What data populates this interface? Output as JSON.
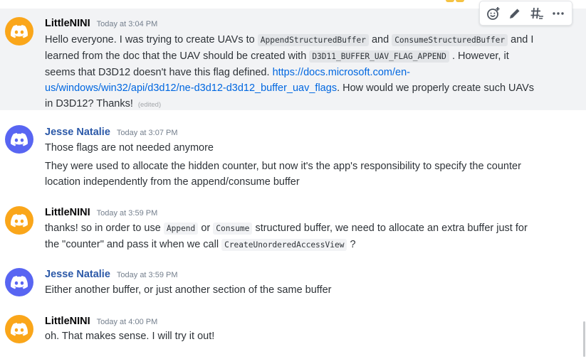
{
  "colors": {
    "avatar_orange": "#faa61a",
    "avatar_blurple": "#5865f2",
    "author_default": "#060607",
    "author_moderator": "#2c59a8",
    "link": "#0067e0",
    "highlight": "#f2f3f5"
  },
  "toolbar": {
    "icons": [
      "add-reaction-icon",
      "edit-pencil-icon",
      "thread-icon",
      "more-dots-icon"
    ]
  },
  "messages": [
    {
      "author": "LittleNINI",
      "timestamp": "Today at 3:04 PM",
      "avatar_icon": "discord-logo-icon",
      "p1_a": "Hello everyone. I was trying to create UAVs to",
      "p1_code1": "AppendStructuredBuffer",
      "p1_b": "and",
      "p1_code2": "ConsumeStructuredBuffer",
      "p1_c": "and I learned from the doc that the UAV should be created with",
      "p1_code3": "D3D11_BUFFER_UAV_FLAG_APPEND",
      "p1_d": ".",
      "p1_e": "However, it seems that D3D12 doesn't have this flag defined.",
      "p1_link": "https://docs.microsoft.com/en-us/windows/win32/api/d3d12/ne-d3d12-d3d12_buffer_uav_flags",
      "p1_f": ". How would we properly create such UAVs in D3D12? Thanks!",
      "edited": "(edited)"
    },
    {
      "author": "Jesse Natalie",
      "timestamp": "Today at 3:07 PM",
      "avatar_icon": "discord-logo-icon",
      "line1": "Those flags are not needed anymore",
      "line2": "They were used to allocate the hidden counter, but now it's the app's responsibility to specify the counter location independently from the append/consume buffer"
    },
    {
      "author": "LittleNINI",
      "timestamp": "Today at 3:59 PM",
      "avatar_icon": "discord-logo-icon",
      "a": "thanks! so in order to use",
      "code1": "Append",
      "b": "or",
      "code2": "Consume",
      "c": "structured buffer, we need to allocate an extra buffer just for the \"counter\" and pass it when we call",
      "code3": "CreateUnorderedAccessView",
      "d": "?"
    },
    {
      "author": "Jesse Natalie",
      "timestamp": "Today at 3:59 PM",
      "avatar_icon": "discord-logo-icon",
      "text": "Either another buffer, or just another section of the same buffer"
    },
    {
      "author": "LittleNINI",
      "timestamp": "Today at 4:00 PM",
      "avatar_icon": "discord-logo-icon",
      "text": "oh. That makes sense. I will try it out!"
    }
  ]
}
